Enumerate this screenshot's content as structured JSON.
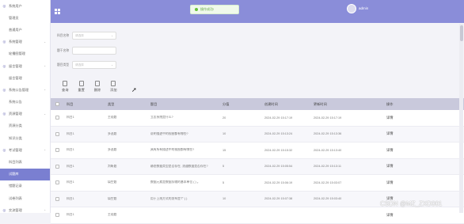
{
  "sidebar": {
    "items": [
      {
        "label": "系统用户",
        "type": "group"
      },
      {
        "label": "管理员",
        "type": "sub"
      },
      {
        "label": "普通用户",
        "type": "sub"
      },
      {
        "label": "系统管理",
        "type": "group"
      },
      {
        "label": "轮播图管理",
        "type": "sub"
      },
      {
        "label": "留言管理",
        "type": "group"
      },
      {
        "label": "留言管理",
        "type": "sub"
      },
      {
        "label": "系统公告管理",
        "type": "group"
      },
      {
        "label": "系统公告",
        "type": "sub"
      },
      {
        "label": "资源管理",
        "type": "group"
      },
      {
        "label": "资源分类",
        "type": "sub"
      },
      {
        "label": "知识分类",
        "type": "sub"
      },
      {
        "label": "考试管理",
        "type": "group"
      },
      {
        "label": "科目列表",
        "type": "sub"
      },
      {
        "label": "试题库",
        "type": "sub",
        "active": true
      },
      {
        "label": "错题记录",
        "type": "sub"
      },
      {
        "label": "试卷列表",
        "type": "sub"
      },
      {
        "label": "交流管理",
        "type": "group"
      }
    ]
  },
  "topbar": {
    "toast": "操作成功!",
    "username": "admin"
  },
  "form": {
    "subject_label": "科目名称",
    "subject_placeholder": "请选择",
    "question_label": "题干名称",
    "question_value": "",
    "type_label": "题目类型",
    "type_placeholder": "请选择"
  },
  "actions": [
    "查询",
    "重置",
    "删除",
    "添加"
  ],
  "table": {
    "headers": [
      "科目",
      "类型",
      "题目",
      "分值",
      "创建时间",
      "更新时间",
      "操作"
    ],
    "rows": [
      [
        "科目1",
        "主观题",
        "立志系统是什么?",
        "20",
        "2024-02-29 15:17:19",
        "2024-02-29 15:17:19",
        "详情"
      ],
      [
        "科目1",
        "多选题",
        "说明描述中的视图都有哪些?",
        "10",
        "2024-02-29 15:13:24",
        "2024-02-29 15:13:36",
        "详情"
      ],
      [
        "科目1",
        "多选题",
        "具有所有描述中的视图都有哪些?",
        "15",
        "2024-02-29 15:15:32",
        "2024-02-29 15:13:40",
        "详情"
      ],
      [
        "科目1",
        "判断题",
        "静态数据类型是否存在, 流通数据是否存在?",
        "5",
        "2024-02-29 15:05:54",
        "2024-02-29 15:13:11",
        "详情"
      ],
      [
        "科目1",
        "填空题",
        "数据元素是数据存储的基本单位 ( ) 。",
        "5",
        "2024-02-29 15:06:19",
        "2024-02-29 15:03:07",
        "详情"
      ],
      [
        "科目1",
        "填空题",
        "用于上线方式的发布是个 ( )",
        "10",
        "2024-02-29 15:07:38",
        "2024-02-29 15:03:40",
        "详情"
      ],
      [
        "科目1",
        "主观题",
        "",
        "",
        "",
        "",
        "详情"
      ]
    ]
  },
  "watermark": "CSDN @MZ_ZXD001"
}
